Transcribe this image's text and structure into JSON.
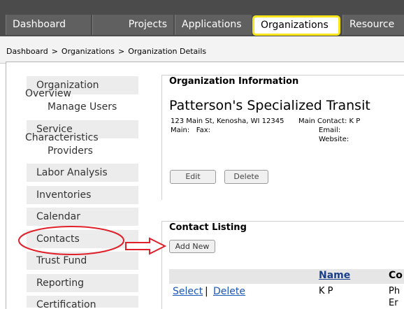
{
  "tabs": [
    "Dashboard",
    "Projects",
    "Applications",
    "Organizations",
    "Resource"
  ],
  "breadcrumb": {
    "items": [
      "Dashboard",
      "Organizations",
      "Organization Details"
    ],
    "separator": ">"
  },
  "sidebar": {
    "items": [
      {
        "label": "Organization",
        "second": "Overview"
      },
      {
        "label": "Manage Users"
      },
      {
        "label": "Service",
        "second": "Characteristics"
      },
      {
        "label": "Providers"
      },
      {
        "label": "Labor Analysis"
      },
      {
        "label": "Inventories"
      },
      {
        "label": "Calendar"
      },
      {
        "label": "Contacts"
      },
      {
        "label": "Trust Fund"
      },
      {
        "label": "Reporting"
      },
      {
        "label": "Certification"
      }
    ]
  },
  "org_info": {
    "legend": "Organization Information",
    "name": "Patterson's Specialized Transit",
    "address": "123 Main St, Kenosha, WI 12345",
    "main": "Main:",
    "fax": "Fax:",
    "main_contact": "Main Contact: K P",
    "email": "Email:",
    "website": "Website:",
    "edit_label": "Edit",
    "delete_label": "Delete"
  },
  "contacts": {
    "legend": "Contact Listing",
    "add_new_label": "Add New",
    "columns": [
      "Name",
      "Co"
    ],
    "rows": [
      {
        "select": "Select",
        "sep": "|",
        "delete": "Delete",
        "name": "K P",
        "extra": "Ph",
        "extra2": "Er"
      }
    ]
  },
  "colors": {
    "topbar": "#4b4b4b",
    "tab": "#606060",
    "highlight": "#f5e51a",
    "annotation": "#e0202a",
    "link": "#1a56b8"
  }
}
